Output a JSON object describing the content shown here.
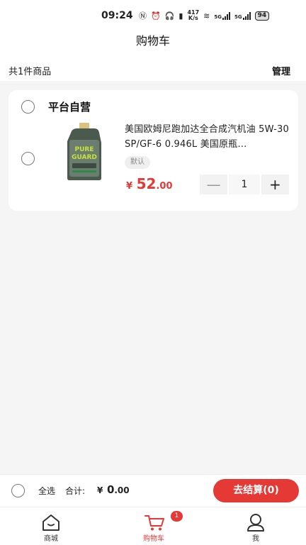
{
  "status_bar": {
    "time": "09:24",
    "network_speed": "417\nK/s",
    "signal_1": "5G",
    "signal_2": "5G",
    "battery": "94"
  },
  "header": {
    "title": "购物车"
  },
  "summary": {
    "count_text": "共1件商品",
    "manage_label": "管理"
  },
  "cart": {
    "store_name": "平台自营",
    "items": [
      {
        "title": "美国欧姆尼跑加达全合成汽机油 5W-30 SP/GF-6 0.946L 美国原瓶...",
        "spec": "默认",
        "price_currency": "¥",
        "price_int": "52",
        "price_dec": ".00",
        "quantity": "1",
        "minus_label": "—",
        "plus_label": "+",
        "image_icon": "motor-oil-bottle-icon"
      }
    ]
  },
  "checkout": {
    "select_all_label": "全选",
    "total_label": "合计:",
    "total_currency": "¥",
    "total_int": "0",
    "total_dec": ".00",
    "button_label": "去结算(0)"
  },
  "tab_bar": {
    "tabs": [
      {
        "label": "商城",
        "icon": "home-icon"
      },
      {
        "label": "购物车",
        "icon": "cart-icon",
        "badge": "1"
      },
      {
        "label": "我",
        "icon": "user-icon"
      }
    ]
  },
  "colors": {
    "accent": "#e53935",
    "background": "#f5f5f5"
  }
}
